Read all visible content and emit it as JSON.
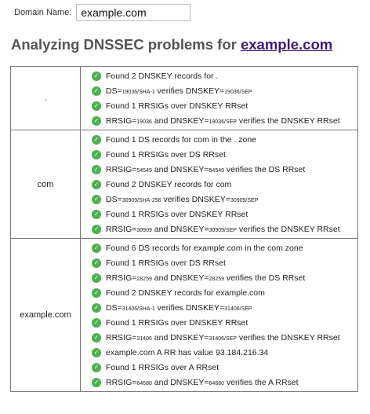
{
  "form": {
    "label": "Domain Name:",
    "value": "example.com"
  },
  "heading": {
    "prefix": "Analyzing DNSSEC problems for ",
    "link": "example.com"
  },
  "icon": {
    "name": "check-circle-icon",
    "color": "#4caf50"
  },
  "zones": [
    {
      "name": ".",
      "checks": [
        [
          "Found 2 DNSKEY records for ."
        ],
        [
          "DS=",
          "s:19036/SHA-1",
          " verifies DNSKEY=",
          "s:19036/SEP"
        ],
        [
          "Found 1 RRSIGs over DNSKEY RRset"
        ],
        [
          "RRSIG=",
          "s:19036",
          " and DNSKEY=",
          "s:19036/SEP",
          " verifies the DNSKEY RRset"
        ]
      ]
    },
    {
      "name": "com",
      "checks": [
        [
          "Found 1 DS records for com in the . zone"
        ],
        [
          "Found 1 RRSIGs over DS RRset"
        ],
        [
          "RRSIG=",
          "s:54549",
          " and DNSKEY=",
          "s:54549",
          " verifies the DS RRset"
        ],
        [
          "Found 2 DNSKEY records for com"
        ],
        [
          "DS=",
          "s:30909/SHA-256",
          " verifies DNSKEY=",
          "s:30909/SEP"
        ],
        [
          "Found 1 RRSIGs over DNSKEY RRset"
        ],
        [
          "RRSIG=",
          "s:30909",
          " and DNSKEY=",
          "s:30909/SEP",
          " verifies the DNSKEY RRset"
        ]
      ]
    },
    {
      "name": "example.com",
      "checks": [
        [
          "Found 6 DS records for example.com in the com zone"
        ],
        [
          "Found 1 RRSIGs over DS RRset"
        ],
        [
          "RRSIG=",
          "s:28259",
          " and DNSKEY=",
          "s:28259",
          " verifies the DS RRset"
        ],
        [
          "Found 2 DNSKEY records for example.com"
        ],
        [
          "DS=",
          "s:31406/SHA-1",
          " verifies DNSKEY=",
          "s:31406/SEP"
        ],
        [
          "Found 1 RRSIGs over DNSKEY RRset"
        ],
        [
          "RRSIG=",
          "s:31406",
          " and DNSKEY=",
          "s:31406/SEP",
          " verifies the DNSKEY RRset"
        ],
        [
          "example.com A RR has value 93.184.216.34"
        ],
        [
          "Found 1 RRSIGs over A RRset"
        ],
        [
          "RRSIG=",
          "s:64680",
          " and DNSKEY=",
          "s:64680",
          " verifies the A RRset"
        ]
      ]
    }
  ]
}
